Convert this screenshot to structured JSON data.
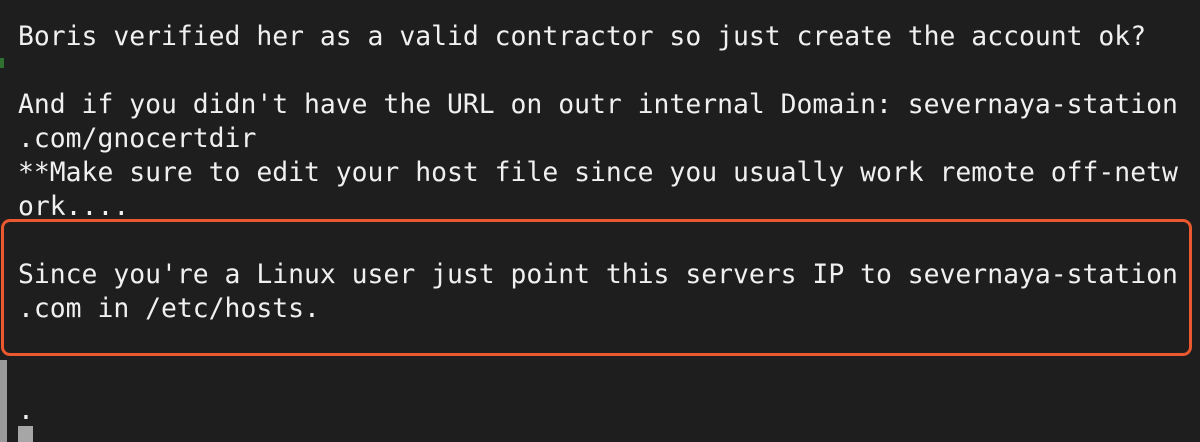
{
  "terminal": {
    "lines": [
      "Boris verified her as a valid contractor so just create the account ok?",
      "And if you didn't have the URL on outr internal Domain: severnaya-station",
      ".com/gnocertdir",
      "**Make sure to edit your host file since you usually work remote off-netw",
      "ork....",
      "Since you're a Linux user just point this servers IP to severnaya-station",
      ".com in /etc/hosts.",
      "."
    ],
    "highlight_color": "#e9582f",
    "background_color": "#1e1e1e",
    "text_color": "#f0f0f0"
  }
}
